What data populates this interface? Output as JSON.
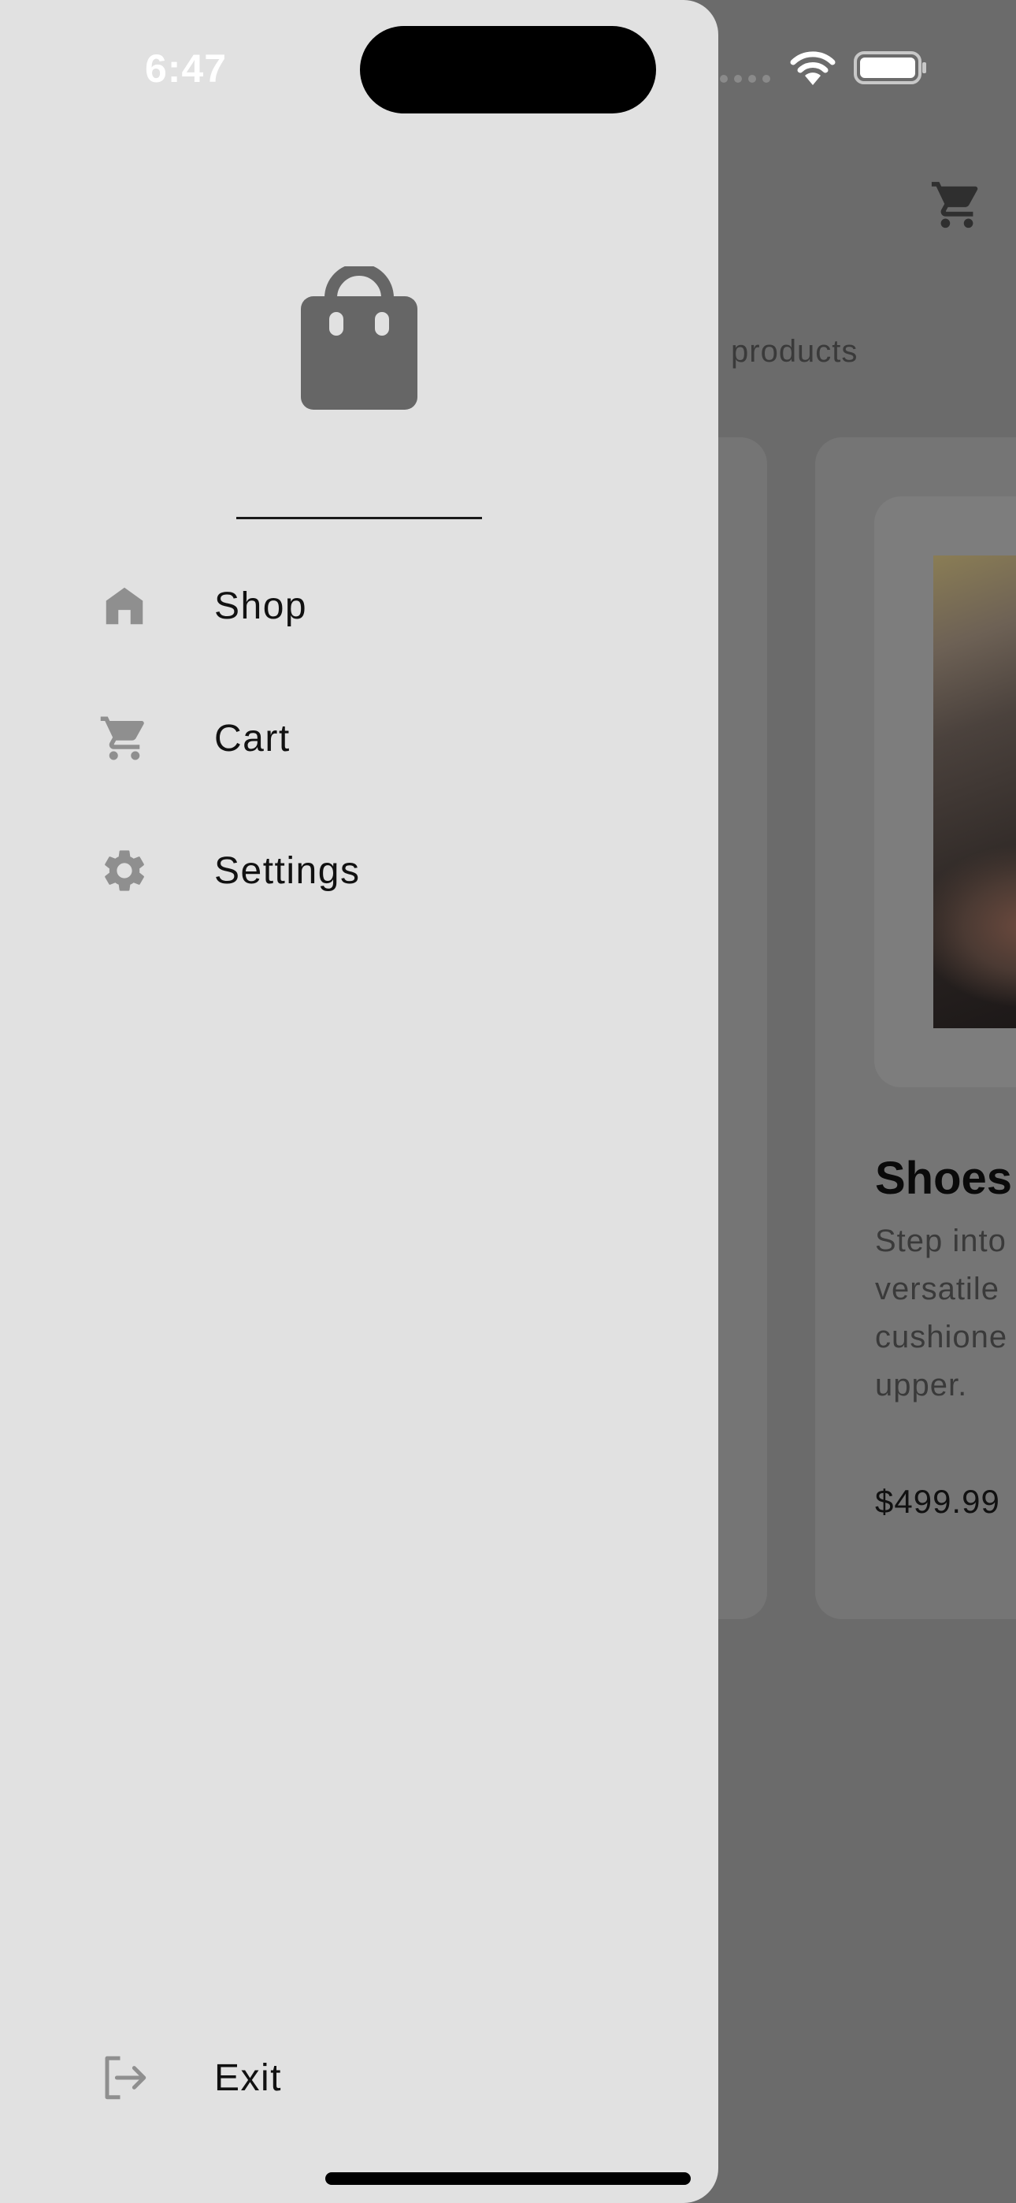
{
  "status_bar": {
    "time": "6:47"
  },
  "drawer": {
    "logo_icon": "shopping-bag-icon",
    "menu": [
      {
        "label": "Shop",
        "icon": "home-icon"
      },
      {
        "label": "Cart",
        "icon": "cart-icon"
      },
      {
        "label": "Settings",
        "icon": "gear-icon"
      }
    ],
    "exit": {
      "label": "Exit",
      "icon": "logout-icon"
    }
  },
  "background_page": {
    "header_icon": "cart-icon",
    "subtitle_fragment": "products",
    "product": {
      "name_fragment": "Shoes",
      "description_lines": [
        "Step into",
        "versatile",
        "cushione",
        "upper."
      ],
      "price": "$499.99"
    }
  },
  "colors": {
    "drawer_background": "#e1e1e1",
    "scrim": "#6b6b6b",
    "icon_gray": "#8f8f8f",
    "logo_gray": "#666666"
  }
}
